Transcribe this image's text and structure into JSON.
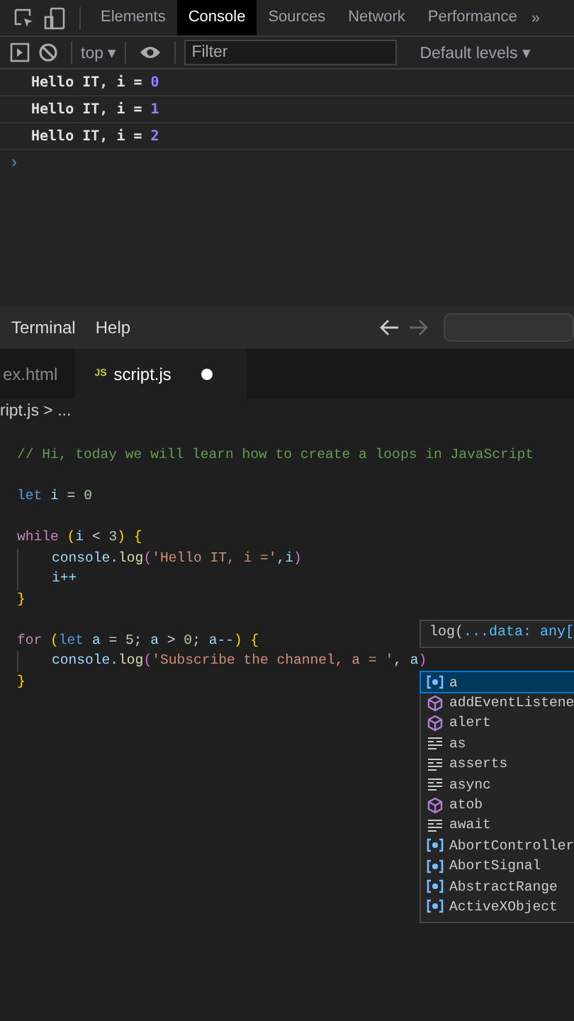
{
  "devtools": {
    "tabs": [
      {
        "label": "Elements",
        "selected": false
      },
      {
        "label": "Console",
        "selected": true
      },
      {
        "label": "Sources",
        "selected": false
      },
      {
        "label": "Network",
        "selected": false
      },
      {
        "label": "Performance",
        "selected": false
      }
    ],
    "more": "»",
    "context": "top ▾",
    "filter": {
      "placeholder": "Filter"
    },
    "levels": "Default levels ▾",
    "console_lines": [
      {
        "text": "Hello IT, i = ",
        "value": "0"
      },
      {
        "text": "Hello IT, i = ",
        "value": "1"
      },
      {
        "text": "Hello IT, i = ",
        "value": "2"
      }
    ],
    "prompt": "›"
  },
  "editor": {
    "menu": [
      "Terminal",
      "Help"
    ],
    "tabs": [
      {
        "label": "ex.html",
        "selected": false,
        "modified": false
      },
      {
        "label": "script.js",
        "badge": "JS",
        "selected": true,
        "modified": true
      }
    ],
    "breadcrumb": "ript.js > ...",
    "code": [
      {
        "kind": "code",
        "indent": false,
        "tokens": [
          {
            "kind": "comment",
            "t": "// Hi, today we will learn how to create a loops in JavaScript"
          }
        ]
      },
      {
        "kind": "blank"
      },
      {
        "kind": "code",
        "indent": false,
        "tokens": [
          {
            "kind": "keyword",
            "t": "let "
          },
          {
            "kind": "var",
            "t": "i"
          },
          {
            "kind": "plain",
            "t": " = "
          },
          {
            "kind": "num",
            "t": "0"
          }
        ]
      },
      {
        "kind": "blank"
      },
      {
        "kind": "code",
        "indent": false,
        "tokens": [
          {
            "kind": "control",
            "t": "while "
          },
          {
            "kind": "paren",
            "t": "("
          },
          {
            "kind": "var",
            "t": "i"
          },
          {
            "kind": "plain",
            "t": " < "
          },
          {
            "kind": "num",
            "t": "3"
          },
          {
            "kind": "paren",
            "t": ") {"
          }
        ]
      },
      {
        "kind": "code",
        "indent": true,
        "tokens": [
          {
            "kind": "var",
            "t": "console."
          },
          {
            "kind": "fn",
            "t": "log"
          },
          {
            "kind": "paren2",
            "t": "("
          },
          {
            "kind": "str",
            "t": "'Hello IT, i ='"
          },
          {
            "kind": "var",
            "t": ",i"
          },
          {
            "kind": "paren2",
            "t": ")"
          }
        ]
      },
      {
        "kind": "code",
        "indent": true,
        "tokens": [
          {
            "kind": "var",
            "t": "i++"
          }
        ]
      },
      {
        "kind": "code",
        "indent": false,
        "tokens": [
          {
            "kind": "paren",
            "t": "}"
          }
        ]
      },
      {
        "kind": "blank"
      },
      {
        "kind": "code",
        "indent": false,
        "tokens": [
          {
            "kind": "control",
            "t": "for "
          },
          {
            "kind": "paren",
            "t": "("
          },
          {
            "kind": "keyword",
            "t": "let "
          },
          {
            "kind": "var",
            "t": "a"
          },
          {
            "kind": "plain",
            "t": " = "
          },
          {
            "kind": "num",
            "t": "5"
          },
          {
            "kind": "plain",
            "t": "; "
          },
          {
            "kind": "var",
            "t": "a"
          },
          {
            "kind": "plain",
            "t": " > "
          },
          {
            "kind": "num",
            "t": "0"
          },
          {
            "kind": "plain",
            "t": "; "
          },
          {
            "kind": "var",
            "t": "a--"
          },
          {
            "kind": "paren",
            "t": ") {"
          }
        ]
      },
      {
        "kind": "code",
        "indent": true,
        "tokens": [
          {
            "kind": "var",
            "t": "console."
          },
          {
            "kind": "fn",
            "t": "log"
          },
          {
            "kind": "paren2",
            "t": "("
          },
          {
            "kind": "str",
            "t": "'Subscribe the channel, a = '"
          },
          {
            "kind": "plain",
            "t": ", "
          },
          {
            "kind": "var",
            "t": "a"
          },
          {
            "kind": "paren2",
            "t": ")"
          }
        ]
      },
      {
        "kind": "code",
        "indent": false,
        "tokens": [
          {
            "kind": "paren",
            "t": "}"
          }
        ]
      }
    ],
    "signature": {
      "name": "log(",
      "param": "...data: any["
    },
    "suggestions": [
      {
        "kind": "variable",
        "label": "a",
        "selected": true
      },
      {
        "kind": "method",
        "label": "addEventListene",
        "selected": false
      },
      {
        "kind": "method",
        "label": "alert",
        "selected": false
      },
      {
        "kind": "keyword",
        "label": "as",
        "selected": false
      },
      {
        "kind": "keyword",
        "label": "asserts",
        "selected": false
      },
      {
        "kind": "keyword",
        "label": "async",
        "selected": false
      },
      {
        "kind": "method",
        "label": "atob",
        "selected": false
      },
      {
        "kind": "keyword",
        "label": "await",
        "selected": false
      },
      {
        "kind": "variable",
        "label": "AbortController",
        "selected": false
      },
      {
        "kind": "variable",
        "label": "AbortSignal",
        "selected": false
      },
      {
        "kind": "variable",
        "label": "AbstractRange",
        "selected": false
      },
      {
        "kind": "variable",
        "label": "ActiveXObject",
        "selected": false
      }
    ]
  }
}
